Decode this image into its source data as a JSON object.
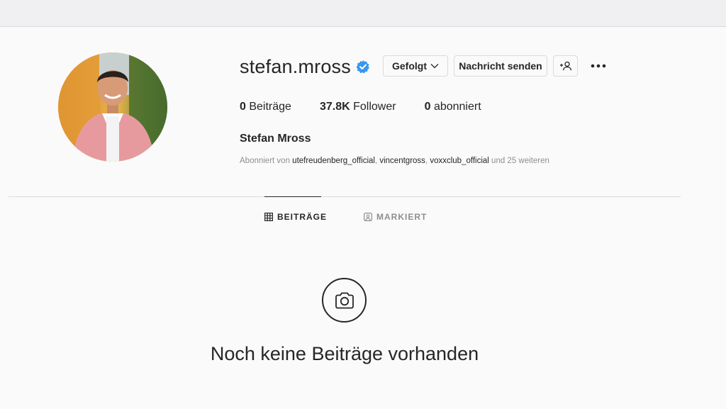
{
  "profile": {
    "username": "stefan.mross",
    "full_name": "Stefan Mross",
    "verified": true,
    "buttons": {
      "follow": "Gefolgt",
      "message": "Nachricht senden"
    },
    "stats": {
      "posts_count": "0",
      "posts_label": "Beiträge",
      "followers_count": "37.8K",
      "followers_label": "Follower",
      "following_count": "0",
      "following_label": "abonniert"
    },
    "followed_by": {
      "prefix": "Abonniert von",
      "accounts": [
        "utefreudenberg_official",
        "vincentgross",
        "voxxclub_official"
      ],
      "suffix": "und 25 weiteren"
    }
  },
  "tabs": [
    {
      "label": "BEITRÄGE",
      "active": true
    },
    {
      "label": "MARKIERT",
      "active": false
    }
  ],
  "empty_state": {
    "text": "Noch keine Beiträge vorhanden"
  },
  "colors": {
    "verified_blue": "#3897f0",
    "text": "#262626",
    "muted": "#8e8e8e",
    "border": "#dbdbdb",
    "background": "#fafafa"
  }
}
